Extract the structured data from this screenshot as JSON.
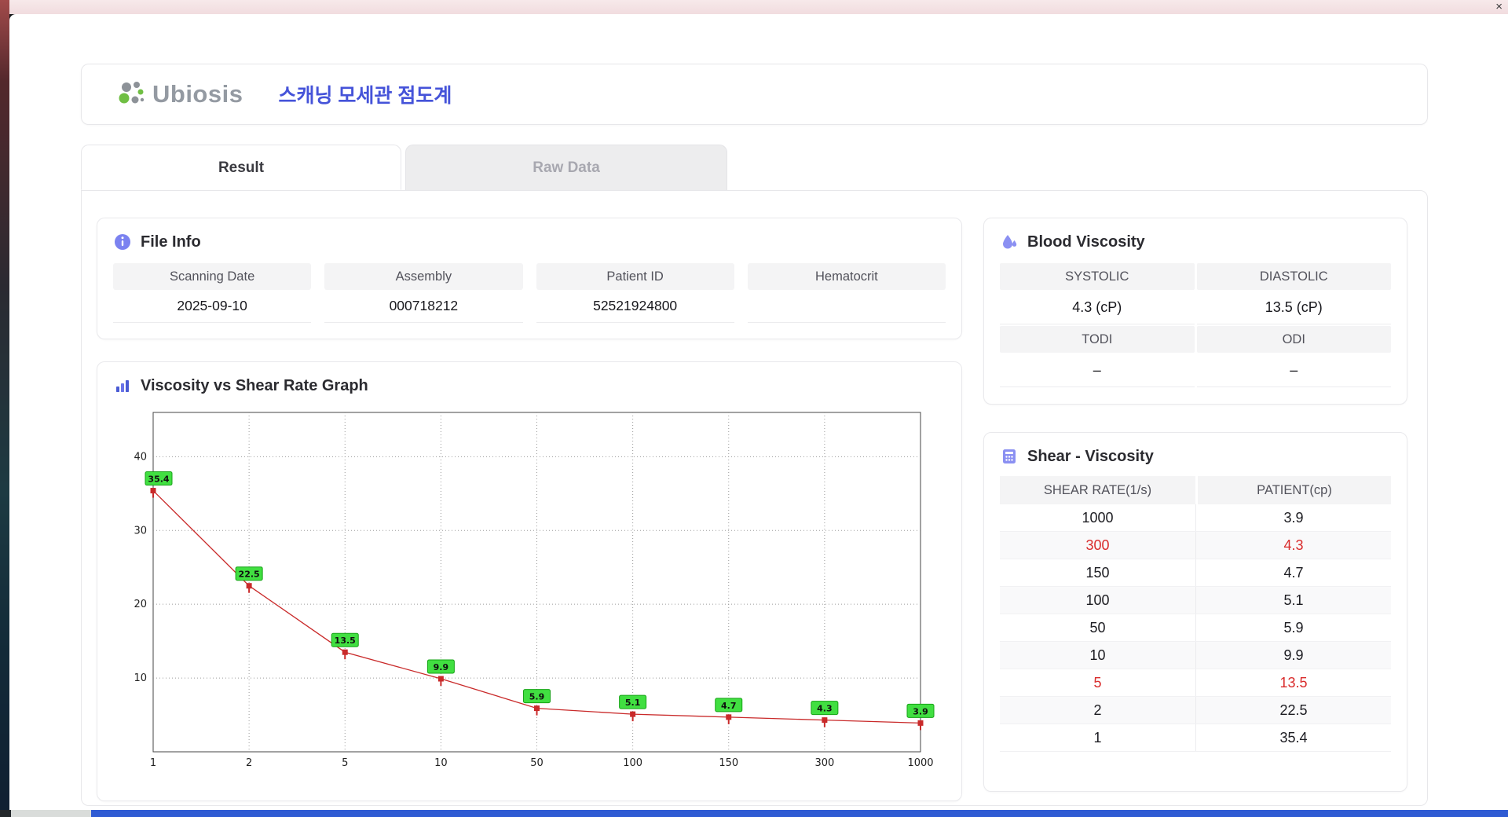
{
  "window": {
    "close_label": "×"
  },
  "header": {
    "logo_text": "Ubiosis",
    "title": "스캐닝 모세관 점도계",
    "title_color": "#4553d9"
  },
  "tabs": [
    {
      "label": "Result",
      "active": true
    },
    {
      "label": "Raw Data",
      "active": false
    }
  ],
  "file_info": {
    "title": "File Info",
    "fields": [
      {
        "label": "Scanning Date",
        "value": "2025-09-10"
      },
      {
        "label": "Assembly",
        "value": "000718212"
      },
      {
        "label": "Patient ID",
        "value": "52521924800"
      },
      {
        "label": "Hematocrit",
        "value": ""
      }
    ]
  },
  "graph": {
    "title": "Viscosity vs Shear Rate Graph"
  },
  "blood_viscosity": {
    "title": "Blood Viscosity",
    "cells": [
      {
        "label": "SYSTOLIC",
        "value": "4.3 (cP)"
      },
      {
        "label": "DIASTOLIC",
        "value": "13.5 (cP)"
      },
      {
        "label": "TODI",
        "value": "–"
      },
      {
        "label": "ODI",
        "value": "–"
      }
    ]
  },
  "shear_viscosity": {
    "title": "Shear - Viscosity",
    "columns": [
      "SHEAR RATE(1/s)",
      "PATIENT(cp)"
    ],
    "highlight_color": "#d92b2b",
    "rows": [
      {
        "shear": "1000",
        "patient": "3.9",
        "highlight": false
      },
      {
        "shear": "300",
        "patient": "4.3",
        "highlight": true
      },
      {
        "shear": "150",
        "patient": "4.7",
        "highlight": false
      },
      {
        "shear": "100",
        "patient": "5.1",
        "highlight": false
      },
      {
        "shear": "50",
        "patient": "5.9",
        "highlight": false
      },
      {
        "shear": "10",
        "patient": "9.9",
        "highlight": false
      },
      {
        "shear": "5",
        "patient": "13.5",
        "highlight": true
      },
      {
        "shear": "2",
        "patient": "22.5",
        "highlight": false
      },
      {
        "shear": "1",
        "patient": "35.4",
        "highlight": false
      }
    ]
  },
  "chart_data": {
    "type": "line",
    "title": "Viscosity vs Shear Rate Graph",
    "x": [
      1,
      2,
      5,
      10,
      50,
      100,
      150,
      300,
      1000
    ],
    "x_scale": "equal-spaced labeled ticks",
    "values": [
      35.4,
      22.5,
      13.5,
      9.9,
      5.9,
      5.1,
      4.7,
      4.3,
      3.9
    ],
    "yticks": [
      10,
      20,
      30,
      40
    ],
    "ylim": [
      0,
      46
    ],
    "xlabel": "",
    "ylabel": "",
    "grid": "dotted",
    "legend": "none",
    "line_color": "#c92a2a",
    "marker": "square",
    "point_label_bg": "#41df41",
    "point_label_border": "#16a316"
  }
}
